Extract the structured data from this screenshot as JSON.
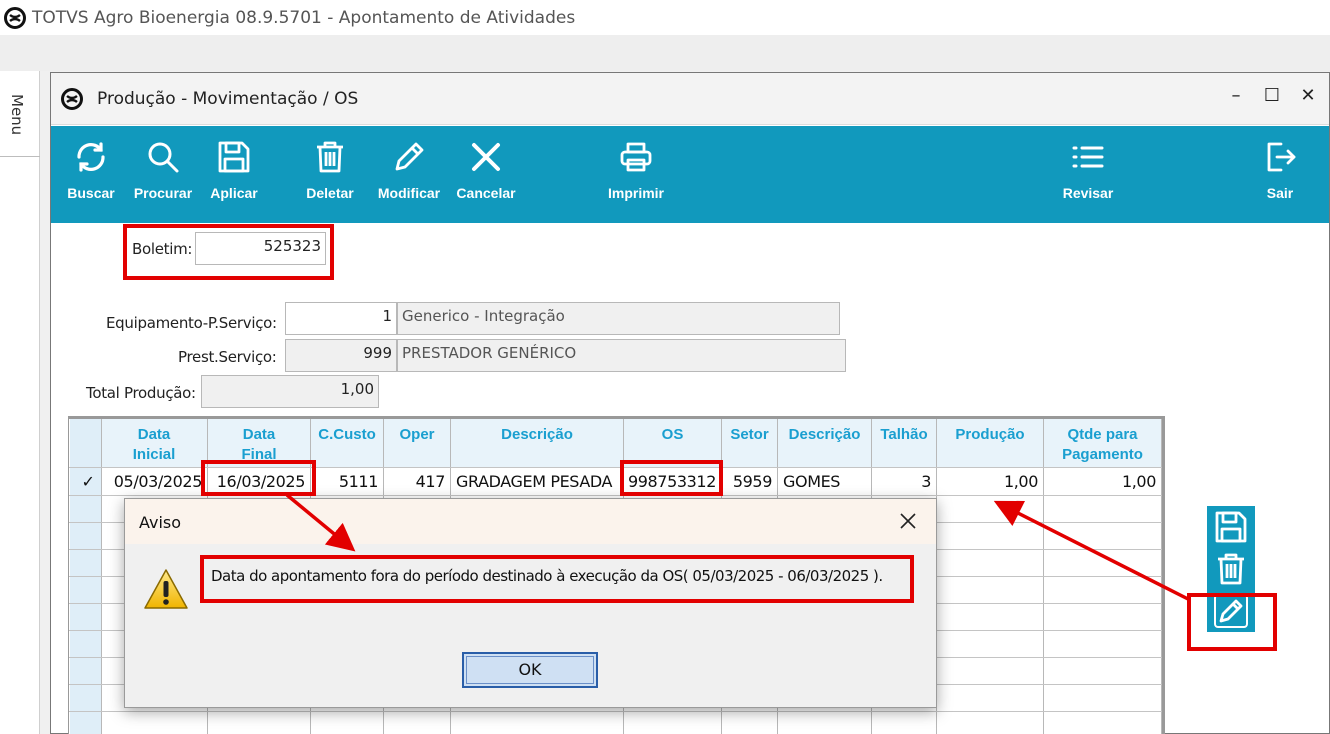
{
  "app": {
    "title": "TOTVS Agro Bioenergia 08.9.5701 - Apontamento de Atividades",
    "menu_label": "Menu"
  },
  "window": {
    "title": "Produção - Movimentação / OS",
    "controls": [
      "–",
      "☐",
      "✕"
    ]
  },
  "toolbar": {
    "color": "#1199bd",
    "buttons": [
      {
        "label": "Buscar",
        "icon": "refresh-icon"
      },
      {
        "label": "Procurar",
        "icon": "search-icon"
      },
      {
        "label": "Aplicar",
        "icon": "save-icon"
      },
      {
        "label": "Deletar",
        "icon": "trash-icon"
      },
      {
        "label": "Modificar",
        "icon": "pencil-icon"
      },
      {
        "label": "Cancelar",
        "icon": "close-icon"
      },
      {
        "label": "Imprimir",
        "icon": "printer-icon"
      },
      {
        "label": "Revisar",
        "icon": "list-icon"
      },
      {
        "label": "Sair",
        "icon": "exit-icon"
      }
    ]
  },
  "form": {
    "boletim": {
      "label": "Boletim:",
      "value": "525323"
    },
    "equipamento": {
      "label": "Equipamento-P.Serviço:",
      "code": "1",
      "description": "Generico - Integração"
    },
    "prestador": {
      "label": "Prest.Serviço:",
      "code": "999",
      "description": "PRESTADOR GENÉRICO"
    },
    "total_producao": {
      "label": "Total Produção:",
      "value": "1,00"
    }
  },
  "grid": {
    "headers": [
      "Data\nInicial",
      "Data\nFinal",
      "C.Custo",
      "Oper",
      "Descrição",
      "OS",
      "Setor",
      "Descrição",
      "Talhão",
      "Produção",
      "Qtde para\nPagamento"
    ],
    "rows": [
      {
        "selected_mark": "✓",
        "data_inicial": "05/03/2025",
        "data_final": "16/03/2025",
        "c_custo": "5111",
        "oper": "417",
        "descricao": "GRADAGEM PESADA",
        "os": "998753312",
        "setor": "5959",
        "descricao_setor": "GOMES",
        "talhao": "3",
        "producao": "1,00",
        "qtde_pagamento": "1,00"
      }
    ]
  },
  "side_tools": [
    "save-icon",
    "trash-icon",
    "pencil-icon"
  ],
  "dialog": {
    "title": "Aviso",
    "message": "Data do apontamento fora do período destinado à execução da OS( 05/03/2025 - 06/03/2025 ).",
    "ok_label": "OK",
    "icon": "warning-icon"
  },
  "annotation_color": "#e20000"
}
